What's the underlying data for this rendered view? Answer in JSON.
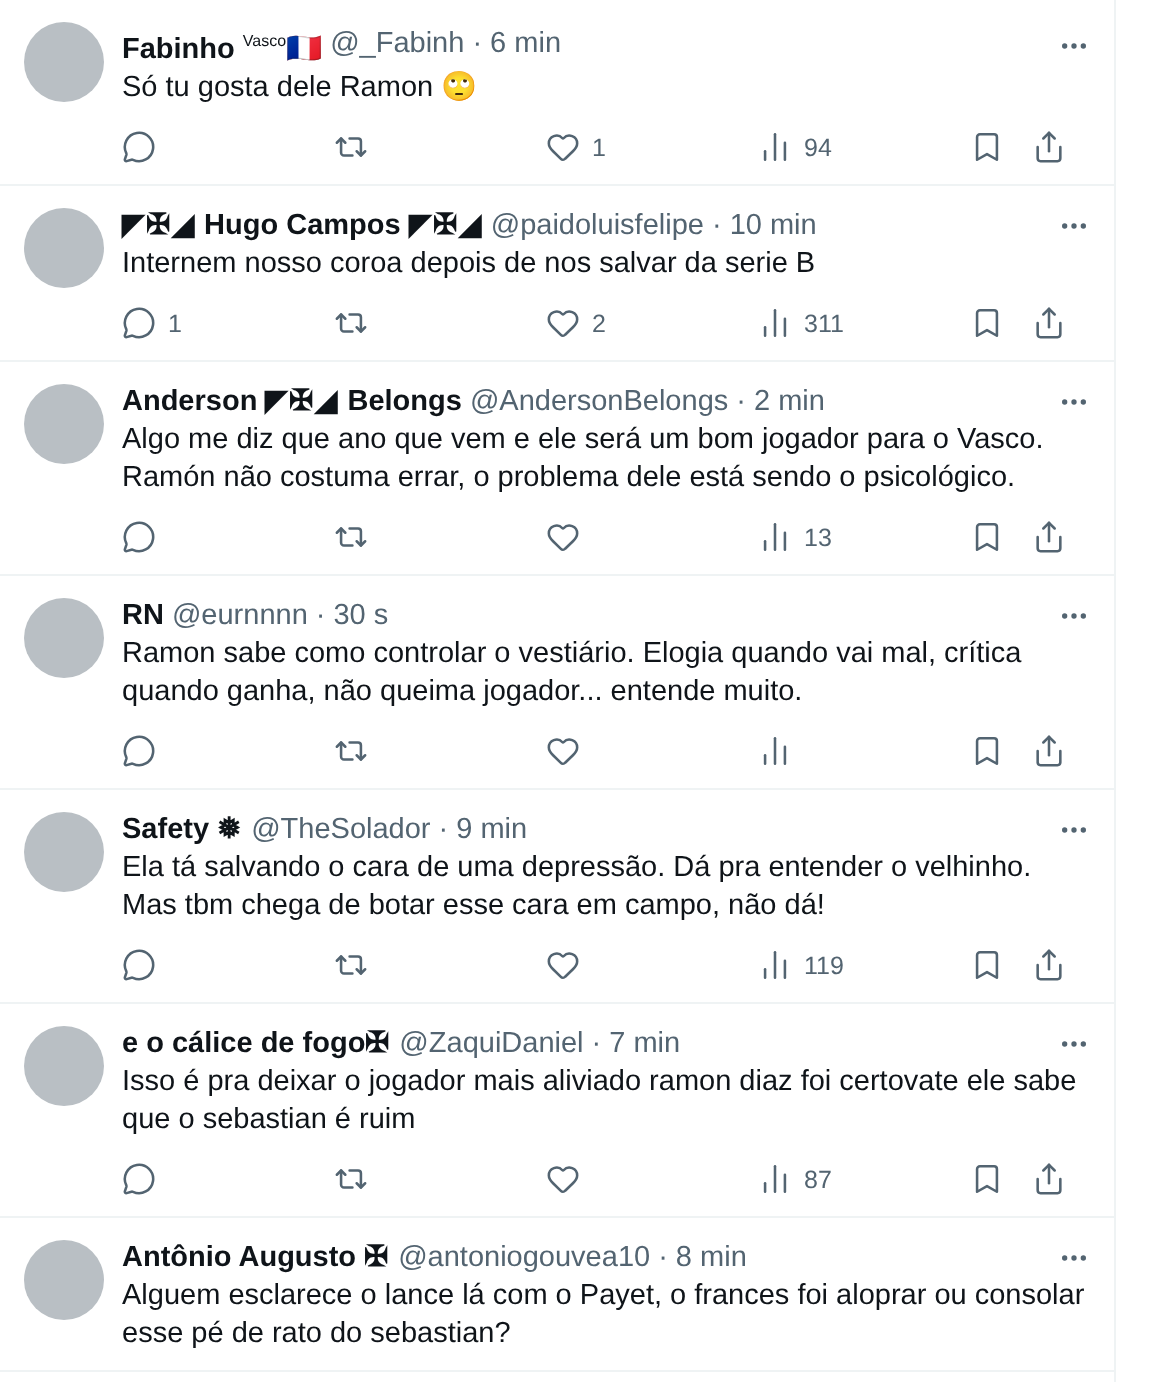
{
  "tweets": [
    {
      "name": "Fabinho $^{Vasco}$🇫🇷",
      "handle": "@_Fabinh",
      "time": "· 6 min",
      "text": "Só tu gosta dele Ramon 🙄",
      "likes": "1",
      "views": "94"
    },
    {
      "name": "◤✠◢ Hugo Campos ◤✠◢",
      "handle": "@paidoluisfelipe",
      "time": "· 10 min",
      "text": "Internem nosso coroa depois de nos salvar da serie B",
      "replies": "1",
      "likes": "2",
      "views": "311"
    },
    {
      "name": "Anderson ◤✠◢ Belongs",
      "handle": "@AndersonBelongs",
      "time": "· 2 min",
      "text": "Algo me diz que ano que vem e ele será um bom jogador para o Vasco. Ramón não costuma errar, o problema dele está sendo o psicológico.",
      "views": "13"
    },
    {
      "name": "RN",
      "handle": "@eurnnnn",
      "time": "· 30 s",
      "text": "Ramon sabe como controlar o vestiário. Elogia quando vai mal, crítica quando ganha, não queima jogador... entende muito."
    },
    {
      "name": "Safety ❅",
      "handle": "@TheSolador",
      "time": "· 9 min",
      "text": "Ela tá salvando o cara de uma depressão. Dá pra entender o velhinho. Mas tbm chega de botar esse cara em campo, não dá!",
      "views": "119"
    },
    {
      "name": "e o cálice de fogo✠",
      "handle": "@ZaquiDaniel",
      "time": "· 7 min",
      "text": "Isso é pra deixar o jogador mais aliviado ramon diaz foi  certovate ele sabe que o sebastian é ruim",
      "views": "87"
    },
    {
      "name": "Antônio Augusto ✠",
      "handle": "@antoniogouvea10",
      "time": "· 8 min",
      "text": "Alguem esclarece o lance lá com o Payet, o frances foi aloprar ou consolar esse pé de rato do sebastian?",
      "partial": true
    }
  ]
}
